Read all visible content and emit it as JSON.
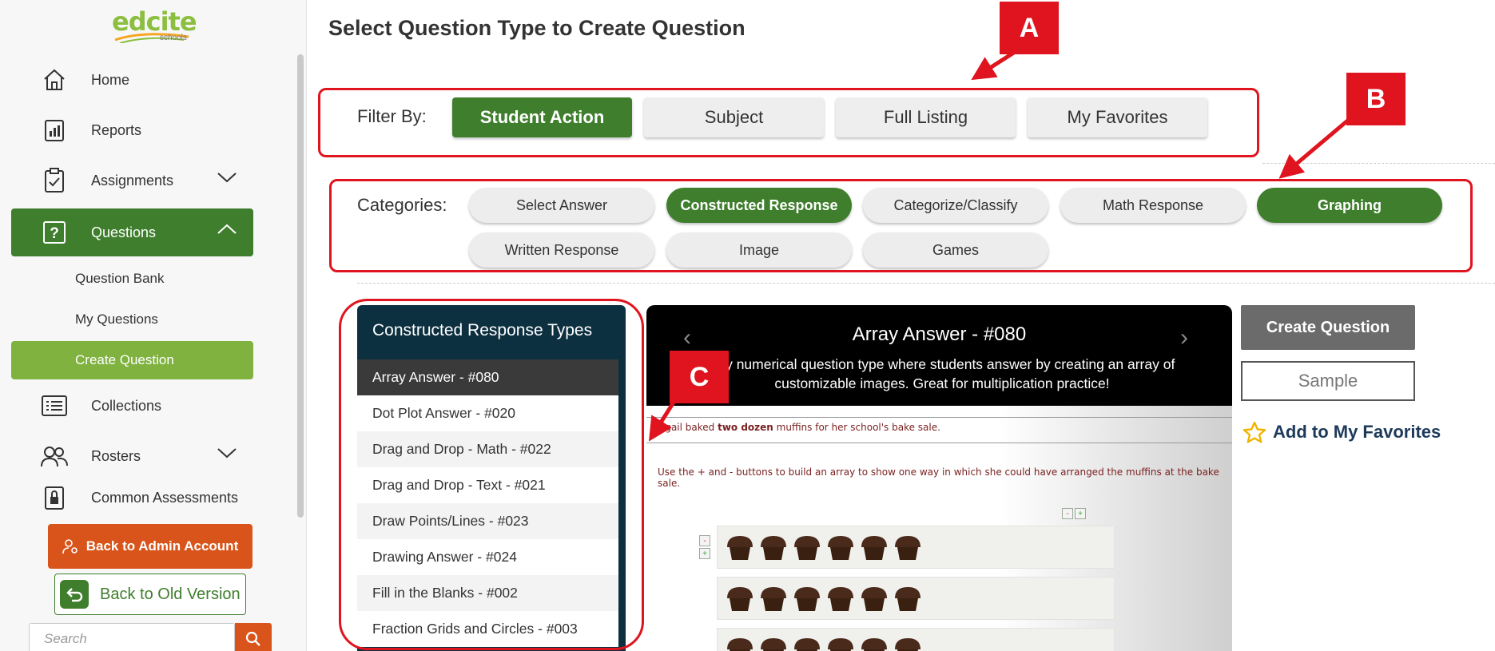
{
  "app": {
    "logo_text": "edcite",
    "logo_sub": "schools"
  },
  "sidebar": {
    "items": [
      {
        "label": "Home",
        "icon": "home-icon"
      },
      {
        "label": "Reports",
        "icon": "reports-icon"
      },
      {
        "label": "Assignments",
        "icon": "clipboard-check-icon"
      },
      {
        "label": "Questions",
        "icon": "question-icon"
      },
      {
        "label": "Collections",
        "icon": "list-icon"
      },
      {
        "label": "Rosters",
        "icon": "users-icon"
      },
      {
        "label": "Common Assessments",
        "icon": "lock-icon"
      }
    ],
    "sub_items": [
      "Question Bank",
      "My Questions",
      "Create Question"
    ],
    "back_admin": "Back to Admin Account",
    "back_old": "Back to Old Version",
    "search_placeholder": "Search"
  },
  "main": {
    "title": "Select Question Type to Create Question",
    "filter_label": "Filter By:",
    "filters": [
      "Student Action",
      "Subject",
      "Full Listing",
      "My Favorites"
    ],
    "categories_label": "Categories:",
    "categories": [
      "Select Answer",
      "Constructed Response",
      "Categorize/Classify",
      "Math Response",
      "Graphing",
      "Written Response",
      "Image",
      "Games"
    ],
    "types_title": "Constructed Response Types",
    "types": [
      "Array Answer - #080",
      "Dot Plot Answer - #020",
      "Drag and Drop - Math - #022",
      "Drag and Drop - Text - #021",
      "Draw Points/Lines - #023",
      "Drawing Answer - #024",
      "Fill in the Blanks - #002",
      "Fraction Grids and Circles - #003"
    ],
    "preview": {
      "title": "Array Answer - #080",
      "description": "tary numerical question type where students answer by creating an array of customizable images. Great for multiplication practice!",
      "prev": "‹",
      "next": "›",
      "sample_text_1a": "igail baked ",
      "sample_text_1b": "two dozen",
      "sample_text_1c": " muffins for her school's bake sale.",
      "sample_text_2": "Use the + and - buttons to build an array to show one way in which she could have arranged the muffins at the bake sale.",
      "minus": "-",
      "plus": "+"
    },
    "create_button": "Create Question",
    "sample_button": "Sample",
    "favorites_link": "Add to My Favorites"
  },
  "annotations": {
    "a": "A",
    "b": "B",
    "c": "C"
  },
  "colors": {
    "primary_green": "#3f7e2d",
    "light_green": "#7fb23f",
    "orange": "#d9541a",
    "annotation_red": "#e0141e",
    "panel_navy": "#0d3040"
  }
}
